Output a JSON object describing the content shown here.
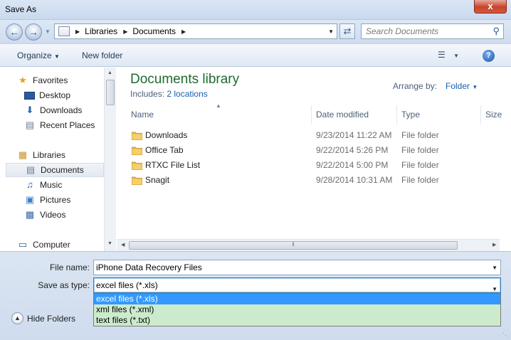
{
  "window": {
    "title": "Save As",
    "close_glyph": "x"
  },
  "address": {
    "crumbs": [
      "Libraries",
      "Documents"
    ],
    "search_placeholder": "Search Documents"
  },
  "toolbar": {
    "organize_label": "Organize",
    "new_folder_label": "New folder"
  },
  "navigation": {
    "favorites_label": "Favorites",
    "favorites": [
      {
        "label": "Desktop",
        "icon": "desktop-icon"
      },
      {
        "label": "Downloads",
        "icon": "downloads-icon"
      },
      {
        "label": "Recent Places",
        "icon": "recent-places-icon"
      }
    ],
    "libraries_label": "Libraries",
    "libraries": [
      {
        "label": "Documents",
        "icon": "documents-icon",
        "selected": true
      },
      {
        "label": "Music",
        "icon": "music-icon"
      },
      {
        "label": "Pictures",
        "icon": "pictures-icon"
      },
      {
        "label": "Videos",
        "icon": "videos-icon"
      }
    ],
    "computer_label": "Computer"
  },
  "library": {
    "title": "Documents library",
    "includes_prefix": "Includes:",
    "includes_link": "2 locations",
    "arrange_label": "Arrange by:",
    "arrange_value": "Folder"
  },
  "columns": [
    "Name",
    "Date modified",
    "Type",
    "Size"
  ],
  "files": [
    {
      "name": "Downloads",
      "date": "9/23/2014 11:22 AM",
      "type": "File folder"
    },
    {
      "name": "Office Tab",
      "date": "9/22/2014 5:26 PM",
      "type": "File folder"
    },
    {
      "name": "RTXC File List",
      "date": "9/22/2014 5:00 PM",
      "type": "File folder"
    },
    {
      "name": "Snagit",
      "date": "9/28/2014 10:31 AM",
      "type": "File folder"
    }
  ],
  "save": {
    "file_name_label": "File name:",
    "file_name_value": "iPhone Data Recovery Files",
    "type_label": "Save as type:",
    "type_value": "excel files (*.xls)",
    "type_options": [
      "excel files (*.xls)",
      "xml files (*.xml)",
      "text files (*.txt)"
    ],
    "selected_option_index": 0
  },
  "hide_folders_label": "Hide Folders",
  "colors": {
    "library_title": "#1e6b2f",
    "link": "#1a5fb4",
    "selection": "#3399ff",
    "dropdown_bg": "#ccebcc"
  }
}
